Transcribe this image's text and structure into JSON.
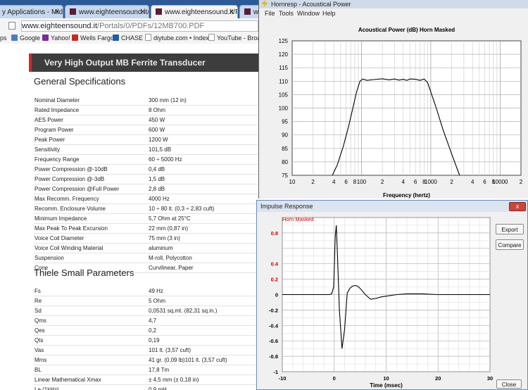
{
  "browser": {
    "tabs": [
      {
        "label": "y Applications - Midbas",
        "active": false
      },
      {
        "label": "www.eighteensound.it/Po",
        "active": false
      },
      {
        "label": "www.eighteensound.it/Po",
        "active": true
      },
      {
        "label": "ww",
        "active": false
      }
    ],
    "url": {
      "host": "www.eighteensound.it",
      "path": "/Portals/0/PDFs/12MB700.PDF"
    },
    "bookmarks": [
      {
        "label": "ps",
        "icon": "apps-icon",
        "color": "#4a7ac7"
      },
      {
        "label": "Google",
        "icon": "google-icon",
        "color": "#4a7ac7"
      },
      {
        "label": "Yahoo!",
        "icon": "yahoo-icon",
        "color": "#7b2a9b"
      },
      {
        "label": "Wells Fargo",
        "icon": "wells-fargo-icon",
        "color": "#c8281e"
      },
      {
        "label": "CHASE",
        "icon": "chase-icon",
        "color": "#1b5ea8"
      },
      {
        "label": "diytube.com • Index...",
        "icon": "page-icon",
        "color": "#999999"
      },
      {
        "label": "YouTube - Broad",
        "icon": "page-icon",
        "color": "#999999"
      }
    ],
    "pdf": {
      "banner": "Very High Output MB Ferrite Transducer",
      "general_title": "General Specifications",
      "general_specs": [
        [
          "Nominal Diameter",
          "300 mm (12 in)"
        ],
        [
          "Rated Impedance",
          "8 Ohm"
        ],
        [
          "AES Power",
          "450 W"
        ],
        [
          "Program Power",
          "600 W"
        ],
        [
          "Peak Power",
          "1200 W"
        ],
        [
          "Sensitivity",
          "101,5 dB"
        ],
        [
          "Frequency Range",
          "60 ÷ 5000 Hz"
        ],
        [
          "Power Compression @-10dB",
          "0,4 dB"
        ],
        [
          "Power Compression @-3dB",
          "1,5 dB"
        ],
        [
          "Power Compression @Full Power",
          "2,8 dB"
        ],
        [
          "Max Recomm. Frequency",
          "4000 Hz"
        ],
        [
          "Recomm. Enclosure Volume",
          "10 ÷ 80 lt. (0,3 ÷ 2,83 cuft)"
        ],
        [
          "Minimum Impedance",
          "5,7 Ohm at 25°C"
        ],
        [
          "Max Peak To Peak Excursion",
          "22 mm (0,87 in)"
        ],
        [
          "Voice Coil Diameter",
          "75 mm (3 in)"
        ],
        [
          "Voice Coil Winding Material",
          "aluminum"
        ],
        [
          "Suspension",
          "M-roll, Polycotton"
        ],
        [
          "Cone",
          "Curvilinear, Paper"
        ]
      ],
      "ts_title": "Thiele Small Parameters",
      "ts_specs": [
        [
          "Fs",
          "49 Hz"
        ],
        [
          "Re",
          "5 Ohm"
        ],
        [
          "Sd",
          "0,0531 sq.mt. (82,31 sq.in.)"
        ],
        [
          "Qms",
          "4,7"
        ],
        [
          "Qes",
          "0,2"
        ],
        [
          "Qts",
          "0,19"
        ],
        [
          "Vas",
          "101 lt. (3,57 cuft)"
        ],
        [
          "Mms",
          "41 gr. (0,09 lb)101 lt. (3,57 cuft)"
        ],
        [
          "BL",
          "17,8 Tm"
        ],
        [
          "Linear Mathematical Xmax",
          "± 4,5 mm (± 0,18 in)"
        ],
        [
          "Le (1kHz)",
          "0,9 mH"
        ]
      ]
    }
  },
  "hornresp": {
    "title": "Hornresp - Acoustical Power",
    "menu": [
      "File",
      "Tools",
      "Window",
      "Help"
    ]
  },
  "impulse": {
    "title": "Impulse Response",
    "close_x": "x",
    "buttons": {
      "export": "Export",
      "compare": "Compare",
      "close": "Close"
    }
  },
  "chart_data": [
    {
      "type": "line",
      "title": "Acoustical Power (dB)   Horn   Masked",
      "xlabel": "Frequency (hertz)",
      "ylabel": "",
      "x_scale": "log",
      "xlim": [
        10,
        20000
      ],
      "ylim": [
        75,
        125
      ],
      "grid": true,
      "y_ticks": [
        75,
        80,
        85,
        90,
        95,
        100,
        105,
        110,
        115,
        120,
        125
      ],
      "x_tick_labels": [
        {
          "f": 10,
          "label": "10"
        },
        {
          "f": 20,
          "label": "2"
        },
        {
          "f": 40,
          "label": "4"
        },
        {
          "f": 60,
          "label": "6"
        },
        {
          "f": 80,
          "label": "8"
        },
        {
          "f": 100,
          "label": "100"
        },
        {
          "f": 200,
          "label": "2"
        },
        {
          "f": 400,
          "label": "4"
        },
        {
          "f": 600,
          "label": "6"
        },
        {
          "f": 800,
          "label": "8"
        },
        {
          "f": 1000,
          "label": "1000"
        },
        {
          "f": 2000,
          "label": "2"
        },
        {
          "f": 4000,
          "label": "4"
        },
        {
          "f": 6000,
          "label": "6"
        },
        {
          "f": 8000,
          "label": "8"
        },
        {
          "f": 10000,
          "label": "10000"
        },
        {
          "f": 20000,
          "label": "2"
        }
      ],
      "series": [
        {
          "x": [
            38,
            45,
            55,
            65,
            75,
            85,
            95,
            105,
            120,
            150,
            200,
            250,
            300,
            350,
            400,
            450,
            500,
            600,
            700,
            800,
            900,
            1000,
            1200,
            1500,
            2000,
            2600
          ],
          "y": [
            75,
            79,
            86,
            93,
            100,
            106,
            110,
            110.8,
            110.3,
            110.6,
            110.9,
            110.5,
            110.8,
            110.4,
            110.7,
            110.3,
            110.8,
            110.7,
            110.3,
            110.8,
            109.5,
            106,
            100,
            92,
            83,
            75
          ]
        }
      ]
    },
    {
      "type": "line",
      "title": "Horn   Masked",
      "xlabel": "Time (msec)",
      "ylabel": "",
      "xlim": [
        -10,
        30
      ],
      "ylim": [
        -1,
        1
      ],
      "grid": true,
      "x_ticks": [
        -10,
        0,
        10,
        20,
        30
      ],
      "y_ticks": [
        -1,
        -0.8,
        -0.6,
        -0.4,
        -0.2,
        0,
        0.2,
        0.4,
        0.8
      ],
      "series": [
        {
          "x": [
            -12,
            -1,
            -0.5,
            -0.1,
            0.2,
            0.4,
            0.6,
            1.0,
            1.5,
            2.0,
            2.5,
            3.0,
            3.5,
            4.0,
            4.5,
            5.0,
            6.0,
            7.0,
            8.0,
            9.0,
            10.0,
            12.0,
            14.0,
            17.0,
            20.0,
            24.0,
            28.0,
            31.0
          ],
          "y": [
            0,
            0,
            0.01,
            0.1,
            0.75,
            0.9,
            0.55,
            -0.2,
            -0.7,
            -0.45,
            0.02,
            0.08,
            0.11,
            0.12,
            0.11,
            0.08,
            0.0,
            -0.06,
            -0.05,
            -0.03,
            -0.02,
            0.0,
            0.01,
            0.01,
            0.0,
            0.0,
            0.0,
            0.0
          ]
        }
      ]
    }
  ]
}
